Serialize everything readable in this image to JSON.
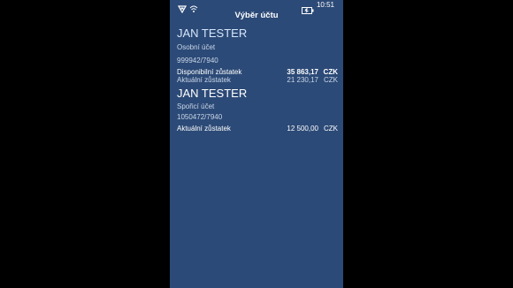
{
  "status": {
    "time": "10:51",
    "icons": [
      "network-icon",
      "wifi-icon",
      "battery-icon"
    ]
  },
  "header": {
    "title": "Výběr účtu"
  },
  "accounts": [
    {
      "owner": "JAN TESTER",
      "type": "Osobní účet",
      "number": "999942/7940",
      "balances": [
        {
          "label": "Disponibilní zůstatek",
          "value": "35 863,17",
          "currency": "CZK"
        },
        {
          "label": "Aktuální zůstatek",
          "value": "21 230,17",
          "currency": "CZK"
        }
      ]
    },
    {
      "owner": "JAN TESTER",
      "type": "Spořicí účet",
      "number": "1050472/7940",
      "balances": [
        {
          "label": "Aktuální zůstatek",
          "value": "12 500,00",
          "currency": "CZK"
        }
      ]
    }
  ],
  "colors": {
    "background": "#2c4a77",
    "outer": "#000000",
    "text": "#ffffff",
    "muted": "#c9d6e8",
    "highlight_name": "#d6e6fb"
  }
}
